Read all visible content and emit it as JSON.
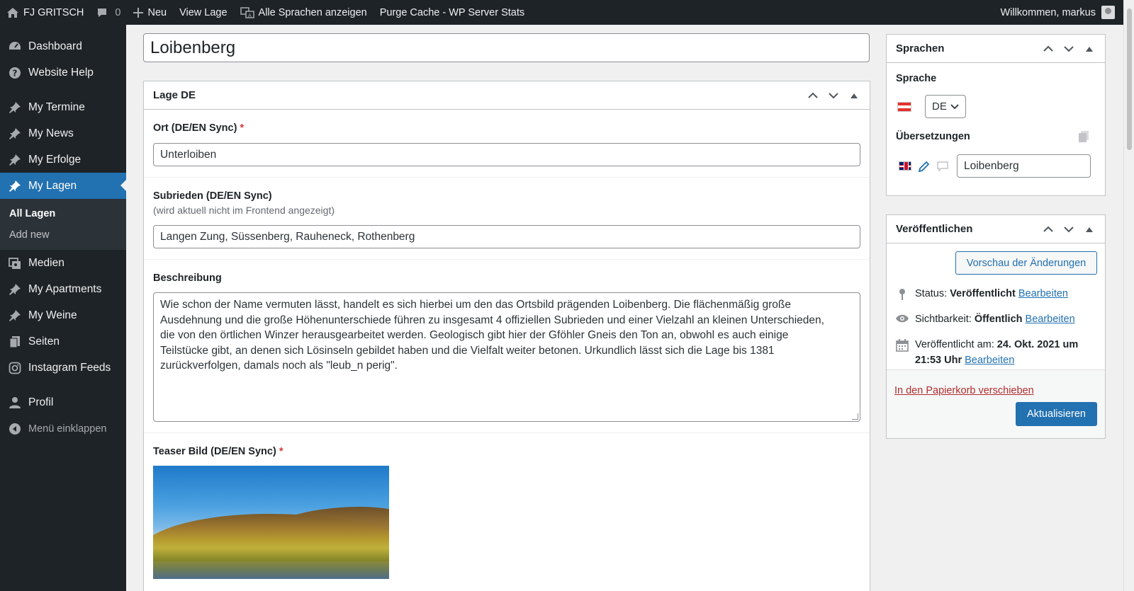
{
  "adminbar": {
    "site_name": "FJ GRITSCH",
    "comments_count": "0",
    "new_label": "Neu",
    "view_label": "View Lage",
    "languages_label": "Alle Sprachen anzeigen",
    "purge_label": "Purge Cache - WP Server Stats",
    "welcome": "Willkommen, markus"
  },
  "sidebar": {
    "items": [
      {
        "label": "Dashboard",
        "icon": "dashboard-icon"
      },
      {
        "label": "Website Help",
        "icon": "help-icon"
      },
      {
        "label": "My Termine",
        "icon": "pin-icon"
      },
      {
        "label": "My News",
        "icon": "pin-icon"
      },
      {
        "label": "My Erfolge",
        "icon": "pin-icon"
      },
      {
        "label": "My Lagen",
        "icon": "pin-icon"
      },
      {
        "label": "Medien",
        "icon": "media-icon"
      },
      {
        "label": "My Apartments",
        "icon": "pin-icon"
      },
      {
        "label": "My Weine",
        "icon": "pin-icon"
      },
      {
        "label": "Seiten",
        "icon": "pages-icon"
      },
      {
        "label": "Instagram Feeds",
        "icon": "instagram-icon"
      },
      {
        "label": "Profil",
        "icon": "user-icon"
      }
    ],
    "submenu": [
      "All Lagen",
      "Add new"
    ],
    "collapse_label": "Menü einklappen"
  },
  "post": {
    "title": "Loibenberg"
  },
  "lage_box": {
    "heading": "Lage DE",
    "ort_label": "Ort (DE/EN Sync)",
    "ort_value": "Unterloiben",
    "subrieden_label": "Subrieden (DE/EN Sync)",
    "subrieden_hint": "(wird aktuell nicht im Frontend angezeigt)",
    "subrieden_value": "Langen Zung, Süssenberg, Rauheneck, Rothenberg",
    "beschreibung_label": "Beschreibung",
    "beschreibung_lines": [
      "Wie schon der Name vermuten lässt, handelt es sich hierbei um den das Ortsbild prägenden Loibenberg. Die flächenmäßig große",
      "Ausdehnung und die große Höhenunterschiede führen zu insgesamt 4 offiziellen Subrieden und einer Vielzahl an kleinen Unterschieden,",
      "die von den örtlichen Winzer herausgearbeitet werden. Geologisch gibt hier der Gföhler Gneis den Ton an, obwohl es auch einige",
      "Teilstücke gibt, an denen sich Lösinseln gebildet haben und die Vielfalt weiter betonen. Urkundlich lässt sich die Lage bis 1381",
      "zurückverfolgen, damals noch als \"leub_n perig\"."
    ],
    "teaser_label": "Teaser Bild (DE/EN Sync)",
    "required_mark": "*"
  },
  "sprachen_box": {
    "heading": "Sprachen",
    "sprache_label": "Sprache",
    "language_value": "DE",
    "uebersetzungen_label": "Übersetzungen",
    "translation_value": "Loibenberg"
  },
  "publish_box": {
    "heading": "Veröffentlichen",
    "preview_label": "Vorschau der Änderungen",
    "status_prefix": "Status: ",
    "status_value": "Veröffentlicht",
    "visibility_prefix": "Sichtbarkeit: ",
    "visibility_value": "Öffentlich",
    "published_prefix": "Veröffentlicht am: ",
    "published_value": "24. Okt. 2021 um 21:53 Uhr",
    "edit_label": "Bearbeiten",
    "trash_label": "In den Papierkorb verschieben",
    "update_label": "Aktualisieren"
  },
  "colors": {
    "accent": "#2271b1",
    "sidebar_bg": "#1d2327",
    "trash": "#b32d2e"
  }
}
